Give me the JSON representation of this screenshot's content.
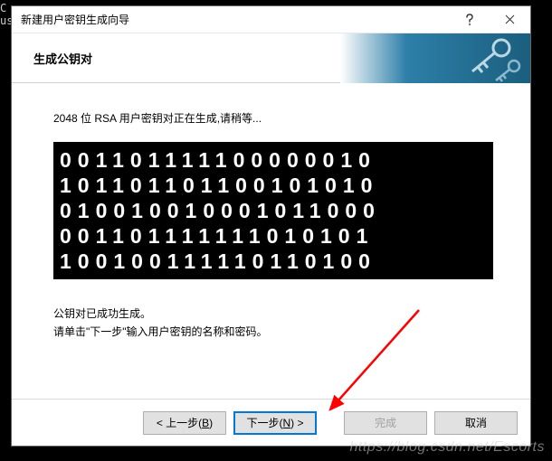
{
  "background_terminal": "C\nus",
  "dialog": {
    "title": "新建用户密钥生成向导",
    "banner_label": "生成公钥对",
    "status_line": "2048 位 RSA 用户密钥对正在生成,请稍等...",
    "bits_rows": [
      "001101111100000010",
      "101101101100101010",
      "010010010001011000",
      "001101111111010101",
      "100100111110110100"
    ],
    "success_line1": "公钥对已成功生成。",
    "success_line2": "请单击\"下一步\"输入用户密钥的名称和密码。"
  },
  "buttons": {
    "back_prefix": "< 上一步(",
    "back_key": "B",
    "back_suffix": ")",
    "next_prefix": "下一步(",
    "next_key": "N",
    "next_suffix": ") >",
    "finish": "完成",
    "cancel": "取消"
  },
  "watermark": "https://blog.csdn.net/Escorts"
}
